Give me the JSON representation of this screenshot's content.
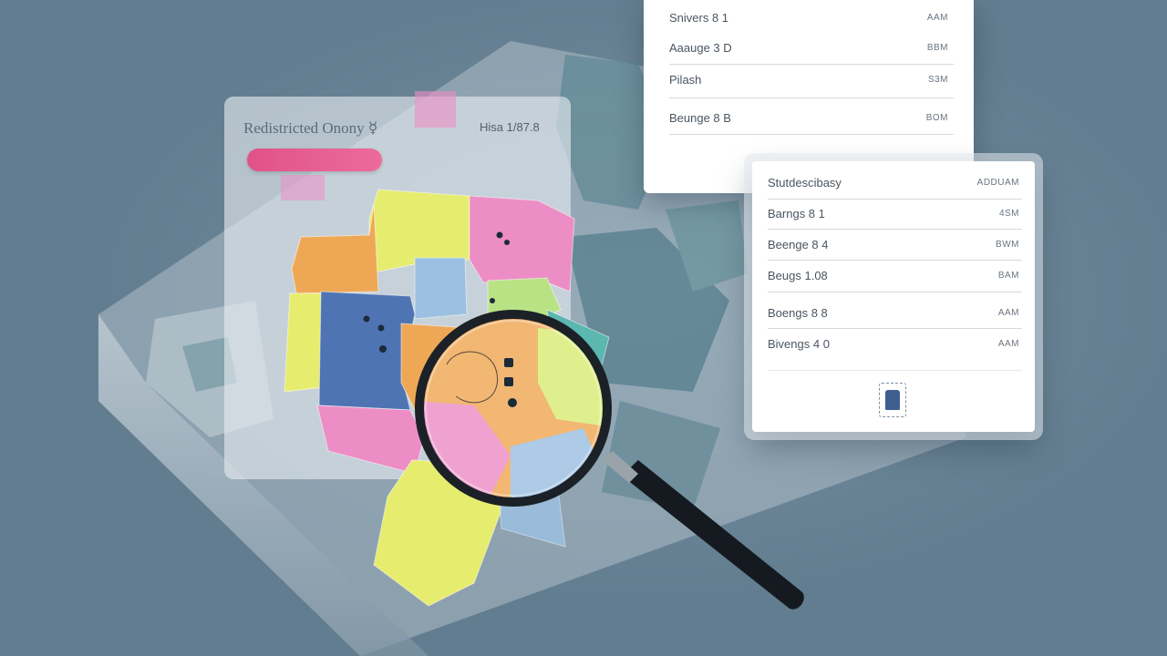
{
  "colors": {
    "background": "#627d8f",
    "district_yellow": "#e6ec6e",
    "district_orange": "#eea855",
    "district_pink": "#ec8ec5",
    "district_blue": "#4e74b4",
    "district_lightblue": "#9cc0e2",
    "district_green": "#b9e285",
    "accent_pink": "#e0528a"
  },
  "map_card": {
    "title": "Redistricted Onony ☿",
    "meta": "Hisa 1/87.8"
  },
  "back_panel": {
    "rows": [
      {
        "label": "Snivers 8 1",
        "value": "AAM"
      },
      {
        "label": "Aaauge 3 D",
        "value": "BBM"
      },
      {
        "label": "Pilash",
        "value": "S3M"
      },
      {
        "label": "Beunge 8 B",
        "value": "BOM"
      }
    ]
  },
  "front_panel": {
    "header": {
      "label": "Stutdescibasy",
      "value": "ADDUAM"
    },
    "rows": [
      {
        "label": "Barngs 8 1",
        "value": "4SM"
      },
      {
        "label": "Beenge 8 4",
        "value": "BWM"
      },
      {
        "label": "Beugs 1.08",
        "value": "BAM"
      },
      {
        "label": "Boengs 8 8",
        "value": "AAM"
      },
      {
        "label": "Bivengs 4 0",
        "value": "AAM"
      }
    ],
    "footer_icon": "document-icon"
  },
  "icons": {
    "magnifier": "magnifying-glass-icon",
    "map_pins": "map-pin-icon"
  }
}
